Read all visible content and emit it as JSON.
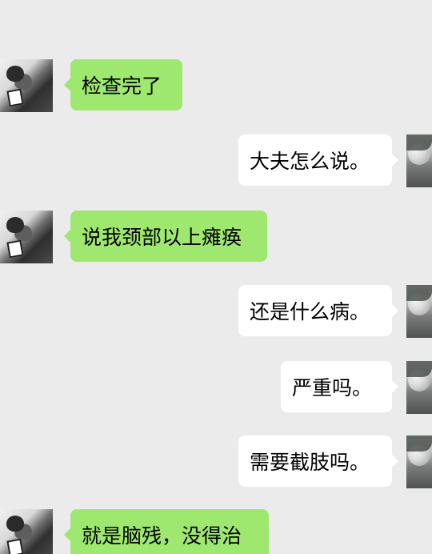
{
  "conversation": {
    "messages": [
      {
        "speaker": "friend",
        "text": "检查完了"
      },
      {
        "speaker": "me",
        "text": "大夫怎么说。"
      },
      {
        "speaker": "friend",
        "text": "说我颈部以上瘫痪"
      },
      {
        "speaker": "me",
        "text": "还是什么病。"
      },
      {
        "speaker": "me",
        "text": "严重吗。"
      },
      {
        "speaker": "me",
        "text": "需要截肢吗。"
      },
      {
        "speaker": "friend",
        "text": "就是脑残，没得治"
      }
    ]
  },
  "colors": {
    "background": "#ebebeb",
    "incoming_bubble": "#9fe870",
    "outgoing_bubble": "#ffffff",
    "text": "#000000"
  },
  "icons": {
    "friend_avatar": "friend-avatar-icon",
    "my_avatar": "my-avatar-icon"
  }
}
